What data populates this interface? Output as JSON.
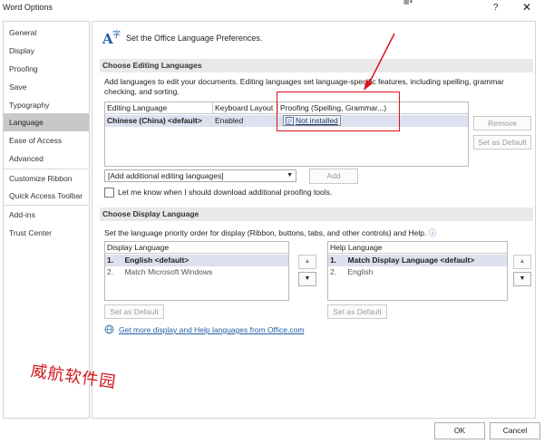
{
  "window": {
    "title": "Word Options",
    "help_label": "?",
    "close_label": "✕",
    "mini_label": "▦▾"
  },
  "sidebar": {
    "items": [
      {
        "label": "General"
      },
      {
        "label": "Display"
      },
      {
        "label": "Proofing"
      },
      {
        "label": "Save"
      },
      {
        "label": "Typography"
      },
      {
        "label": "Language",
        "selected": true
      },
      {
        "label": "Ease of Access"
      },
      {
        "label": "Advanced"
      },
      {
        "label": "Customize Ribbon"
      },
      {
        "label": "Quick Access Toolbar"
      },
      {
        "label": "Add-ins"
      },
      {
        "label": "Trust Center"
      }
    ]
  },
  "header": {
    "icon": "language-icon",
    "icon_glyph": "A字",
    "text": "Set the Office Language Preferences."
  },
  "editing": {
    "section_title": "Choose Editing Languages",
    "description": "Add languages to edit your documents. Editing languages set language-specific features, including spelling, grammar checking, and sorting.",
    "columns": [
      "Editing Language",
      "Keyboard Layout",
      "Proofing (Spelling, Grammar...)"
    ],
    "rows": [
      {
        "language": "Chinese (China) <default>",
        "keyboard": "Enabled",
        "proofing": "Not installed"
      }
    ],
    "remove_label": "Remove",
    "set_default_label": "Set as Default",
    "add_dropdown_value": "[Add additional editing languages]",
    "add_label": "Add",
    "notify_checkbox_label": "Let me know when I should download additional proofing tools.",
    "notify_checked": false
  },
  "display": {
    "section_title": "Choose Display Language",
    "description": "Set the language priority order for display (Ribbon, buttons, tabs, and other controls) and Help.",
    "info_glyph": "ⓘ",
    "display_list": {
      "header": "Display Language",
      "items": [
        {
          "num": "1.",
          "label": "English <default>",
          "selected": true
        },
        {
          "num": "2.",
          "label": "Match Microsoft Windows",
          "selected": false
        }
      ]
    },
    "help_list": {
      "header": "Help Language",
      "items": [
        {
          "num": "1.",
          "label": "Match Display Language <default>",
          "selected": true
        },
        {
          "num": "2.",
          "label": "English",
          "selected": false
        }
      ]
    },
    "set_default_label": "Set as Default",
    "up_arrow": "▲",
    "down_arrow": "▼",
    "link_text": "Get more display and Help languages from Office.com"
  },
  "footer": {
    "ok_label": "OK",
    "cancel_label": "Cancel"
  },
  "watermark": {
    "text": "威航软件园"
  },
  "colors": {
    "annotation_red": "#e0121c",
    "link_blue": "#1f5fa8",
    "selected_nav": "#c8c8c8",
    "selected_row": "#dde0ee"
  }
}
